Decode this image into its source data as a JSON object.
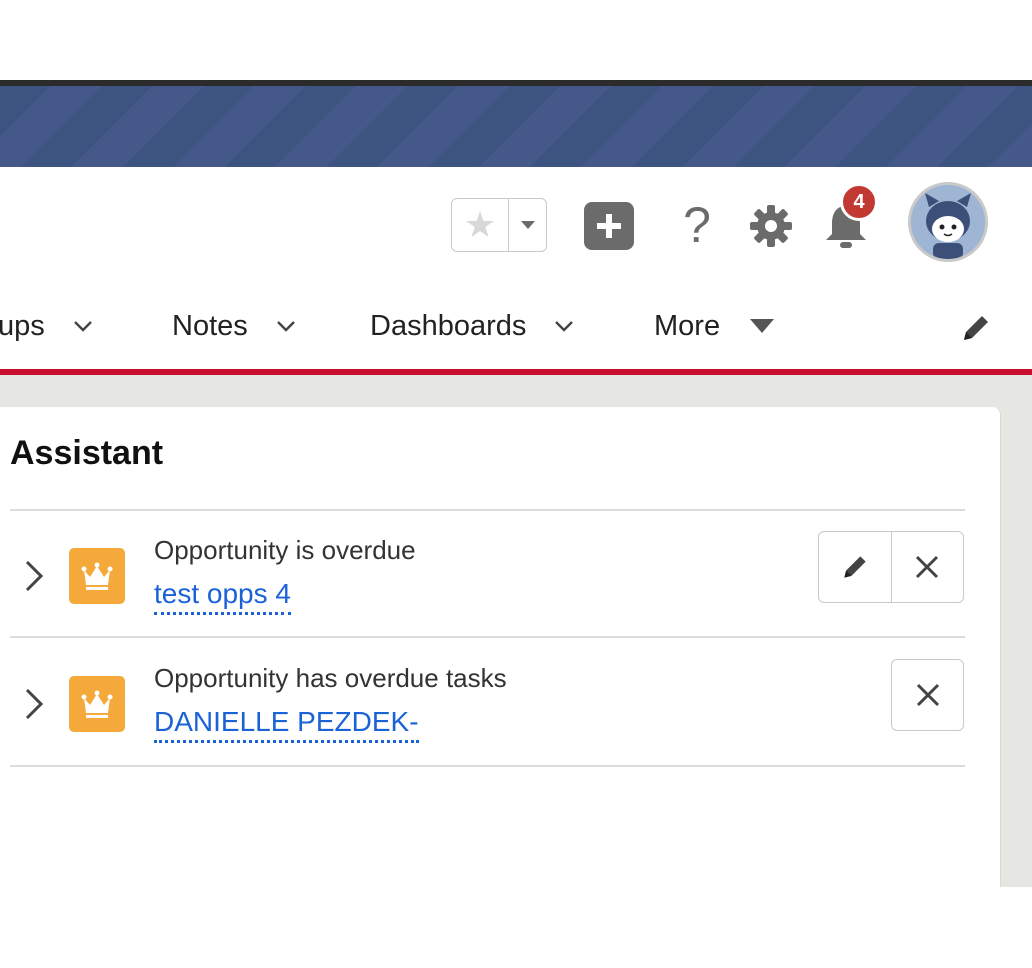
{
  "header": {
    "notification_count": "4",
    "help_glyph": "?"
  },
  "nav": {
    "items": [
      {
        "label": "ups"
      },
      {
        "label": "Notes"
      },
      {
        "label": "Dashboards"
      },
      {
        "label": "More"
      }
    ]
  },
  "assistant": {
    "title": "Assistant",
    "items": [
      {
        "description": "Opportunity is overdue",
        "link": "test opps 4"
      },
      {
        "description": "Opportunity has overdue tasks",
        "link": "DANIELLE PEZDEK-"
      }
    ]
  },
  "colors": {
    "banner": "#3d5480",
    "accent_red": "#c8102e",
    "badge_red": "#c23934",
    "link_blue": "#1a62d6",
    "opportunity_orange": "#f6a93b"
  },
  "icons": [
    "star-icon",
    "dropdown-caret-icon",
    "plus-icon",
    "help-icon",
    "gear-icon",
    "bell-icon",
    "avatar-icon",
    "chevron-down-icon",
    "edit-pencil-icon",
    "chevron-right-icon",
    "crown-icon",
    "close-icon"
  ]
}
